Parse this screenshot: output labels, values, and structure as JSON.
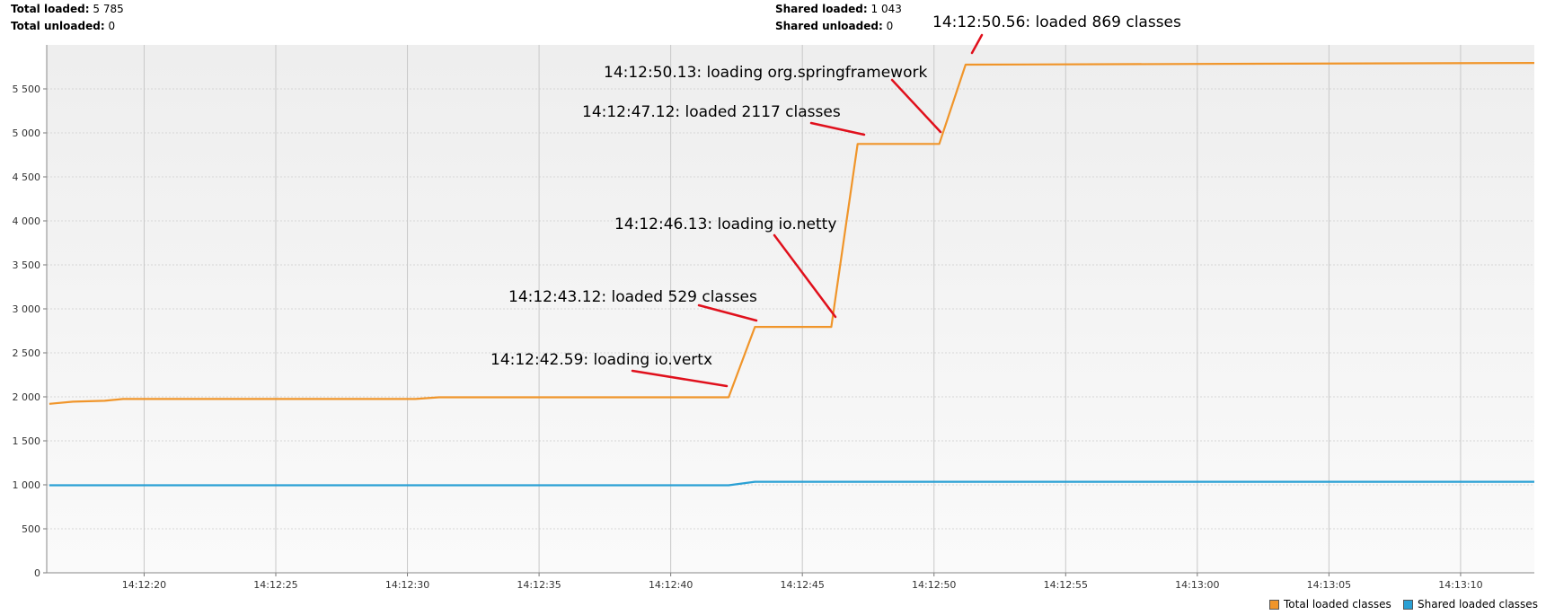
{
  "stats": {
    "total_loaded_label": "Total loaded:",
    "total_loaded_value": "5 785",
    "total_unloaded_label": "Total unloaded:",
    "total_unloaded_value": "0",
    "shared_loaded_label": "Shared loaded:",
    "shared_loaded_value": "1 043",
    "shared_unloaded_label": "Shared unloaded:",
    "shared_unloaded_value": "0"
  },
  "colors": {
    "total": "#f0952a",
    "shared": "#2aa0d4",
    "annotation_arrow": "#e0101c",
    "plot_bg_top": "#eeeeee",
    "plot_bg_bottom": "#fafafa"
  },
  "chart_data": {
    "type": "line",
    "title": "",
    "xlabel": "",
    "ylabel": "",
    "x_unit": "time (HH:MM:SS)",
    "xlim": [
      "14:12:16.3",
      "14:13:12.8"
    ],
    "ylim": [
      0,
      6000
    ],
    "grid": true,
    "legend_placement": "bottom-right",
    "y_ticks": [
      0,
      500,
      1000,
      1500,
      2000,
      2500,
      3000,
      3500,
      4000,
      4500,
      5000,
      5500
    ],
    "y_tick_labels": [
      "0",
      "500",
      "1 000",
      "1 500",
      "2 000",
      "2 500",
      "3 000",
      "3 500",
      "4 000",
      "4 500",
      "5 000",
      "5 500"
    ],
    "x_ticks": [
      "14:12:20",
      "14:12:25",
      "14:12:30",
      "14:12:35",
      "14:12:40",
      "14:12:45",
      "14:12:50",
      "14:12:55",
      "14:13:00",
      "14:13:05",
      "14:13:10"
    ],
    "series": [
      {
        "name": "Total loaded classes",
        "color": "#f0952a",
        "points": [
          [
            "14:12:16.4",
            1920
          ],
          [
            "14:12:17.3",
            1945
          ],
          [
            "14:12:18.5",
            1955
          ],
          [
            "14:12:19.2",
            1975
          ],
          [
            "14:12:30.3",
            1975
          ],
          [
            "14:12:31.2",
            1995
          ],
          [
            "14:12:42.2",
            1995
          ],
          [
            "14:12:43.2",
            2795
          ],
          [
            "14:12:46.1",
            2795
          ],
          [
            "14:12:47.1",
            4875
          ],
          [
            "14:12:50.2",
            4875
          ],
          [
            "14:12:51.2",
            5775
          ],
          [
            "14:13:12.8",
            5795
          ]
        ]
      },
      {
        "name": "Shared loaded classes",
        "color": "#2aa0d4",
        "points": [
          [
            "14:12:16.4",
            995
          ],
          [
            "14:12:42.2",
            995
          ],
          [
            "14:12:43.2",
            1035
          ],
          [
            "14:13:12.8",
            1035
          ]
        ]
      }
    ],
    "annotations": [
      {
        "text": "14:12:50.56: loaded 869 classes"
      },
      {
        "text": "14:12:50.13: loading org.springframework"
      },
      {
        "text": "14:12:47.12: loaded 2117 classes"
      },
      {
        "text": "14:12:46.13: loading io.netty"
      },
      {
        "text": "14:12:43.12: loaded 529 classes"
      },
      {
        "text": "14:12:42.59: loading io.vertx"
      }
    ]
  }
}
